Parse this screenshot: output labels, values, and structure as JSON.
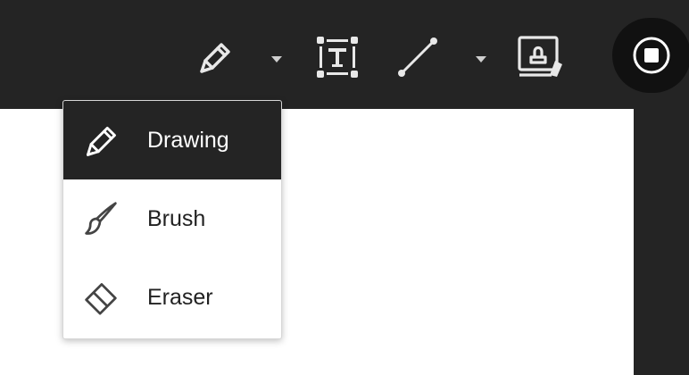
{
  "toolbar": {
    "tools": [
      {
        "name": "pencil-tool",
        "icon": "pencil-icon"
      },
      {
        "name": "pencil-dropdown",
        "icon": "caret-down-icon"
      },
      {
        "name": "text-tool",
        "icon": "text-box-icon"
      },
      {
        "name": "line-tool",
        "icon": "line-icon"
      },
      {
        "name": "line-dropdown",
        "icon": "caret-down-icon"
      },
      {
        "name": "stamp-tool",
        "icon": "stamp-icon"
      },
      {
        "name": "stop-button",
        "icon": "stop-icon"
      }
    ]
  },
  "menu": {
    "items": [
      {
        "label": "Drawing",
        "icon": "pencil-icon",
        "selected": true
      },
      {
        "label": "Brush",
        "icon": "brush-icon",
        "selected": false
      },
      {
        "label": "Eraser",
        "icon": "eraser-icon",
        "selected": false
      }
    ]
  },
  "colors": {
    "toolbar_bg": "#242424",
    "menu_active_bg": "#242424",
    "canvas_bg": "#ffffff",
    "icon_light": "#e8e8e8",
    "text_dark": "#222222"
  }
}
